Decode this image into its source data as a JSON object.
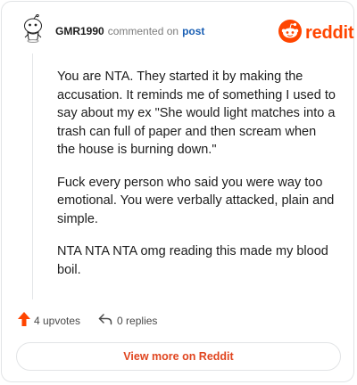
{
  "header": {
    "username": "GMR1990",
    "commented_text": "commented on",
    "post_link": "post"
  },
  "brand": {
    "name": "reddit",
    "icon": "reddit-logo-icon",
    "color": "#ff4500"
  },
  "avatar": {
    "icon": "snoo-avatar-icon"
  },
  "comment": {
    "paragraphs": [
      "You are NTA. They started it by making the accusation. It reminds me of something I used to say about my ex \"She would light matches into a trash can full of paper and then scream when the house is burning down.\"",
      "Fuck every person who said you were way too emotional. You were verbally attacked, plain and simple.",
      "NTA NTA NTA omg reading this made my blood boil."
    ]
  },
  "actions": {
    "upvotes_label": "4 upvotes",
    "upvote_icon": "upvote-arrow-icon",
    "upvote_color": "#ff4500",
    "replies_label": "0 replies",
    "reply_icon": "reply-arrow-icon"
  },
  "footer": {
    "view_more_label": "View more on Reddit",
    "accent": "#e0451f"
  }
}
